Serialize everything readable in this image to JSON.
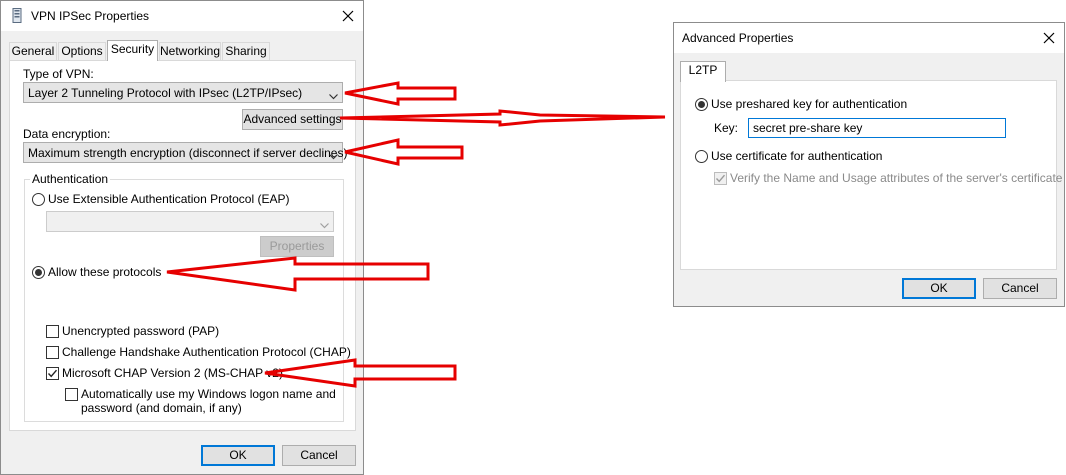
{
  "vpn_dialog": {
    "title": "VPN IPSec Properties",
    "tabs": [
      {
        "label": "General"
      },
      {
        "label": "Options"
      },
      {
        "label": "Security"
      },
      {
        "label": "Networking"
      },
      {
        "label": "Sharing"
      }
    ],
    "active_tab": "Security",
    "type_of_vpn_label": "Type of VPN:",
    "type_of_vpn_value": "Layer 2 Tunneling Protocol with IPsec (L2TP/IPsec)",
    "advanced_settings_label": "Advanced settings",
    "data_encryption_label": "Data encryption:",
    "data_encryption_value": "Maximum strength encryption (disconnect if server declines)",
    "authentication_group_label": "Authentication",
    "eap_radio_label": "Use Extensible Authentication Protocol (EAP)",
    "eap_radio_checked": false,
    "eap_dropdown_value": "",
    "properties_label": "Properties",
    "allow_protocols_label": "Allow these protocols",
    "allow_protocols_checked": true,
    "protocols": [
      {
        "label": "Unencrypted password (PAP)",
        "checked": false
      },
      {
        "label": "Challenge Handshake Authentication Protocol (CHAP)",
        "checked": false
      },
      {
        "label": "Microsoft CHAP Version 2 (MS-CHAP v2)",
        "checked": true
      }
    ],
    "auto_logon_label_line1": "Automatically use my Windows logon name and",
    "auto_logon_label_line2": "password (and domain, if any)",
    "auto_logon_checked": false,
    "ok_label": "OK",
    "cancel_label": "Cancel"
  },
  "advanced_dialog": {
    "title": "Advanced Properties",
    "tab_label": "L2TP",
    "preshared_radio_label": "Use preshared key for authentication",
    "preshared_checked": true,
    "key_label": "Key:",
    "key_value": "secret pre-share key",
    "certificate_radio_label": "Use certificate for authentication",
    "certificate_checked": false,
    "verify_label": "Verify the Name and Usage attributes of the server's certificate",
    "verify_checked": true,
    "ok_label": "OK",
    "cancel_label": "Cancel"
  },
  "colors": {
    "annotation_arrow": "#e60000",
    "focus_border": "#0078d7",
    "dialog_background": "#f0f0f0"
  }
}
